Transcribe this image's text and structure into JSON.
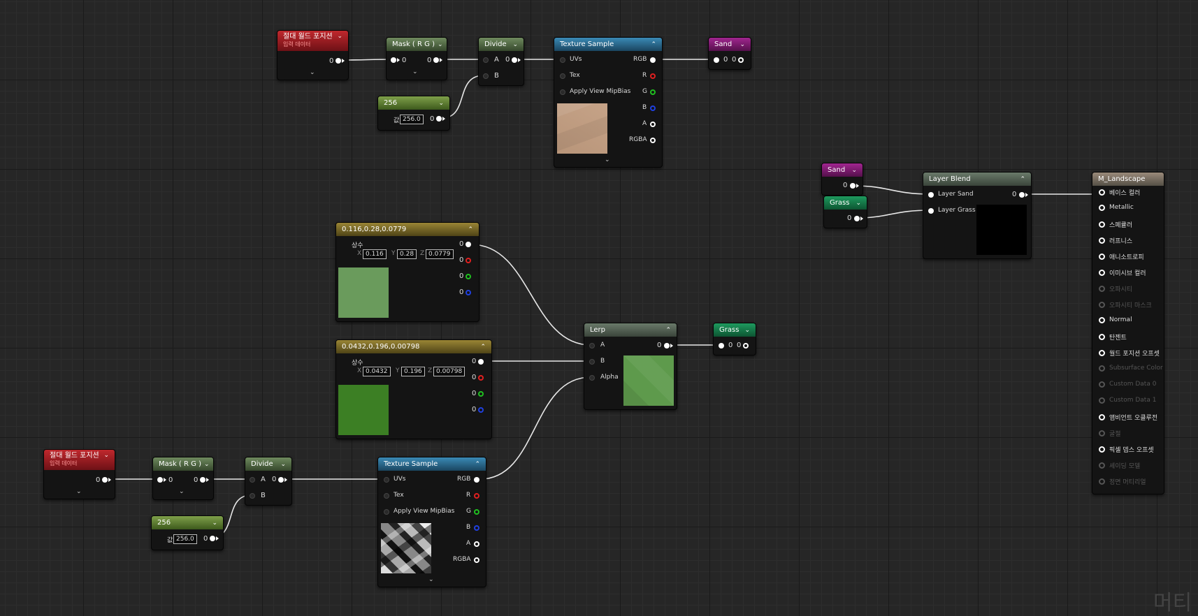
{
  "nodes": {
    "awp_top": {
      "title": "절대 월드 포지션",
      "subtitle": "입력 데이터",
      "out": "0"
    },
    "mask_top": {
      "title": "Mask ( R G )",
      "in": "0",
      "out": "0"
    },
    "divide_top": {
      "title": "Divide",
      "a": "A",
      "a_val": "0",
      "b": "B"
    },
    "const256_top": {
      "title": "256",
      "label": "값",
      "value": "256.0",
      "out": "0"
    },
    "tex_top": {
      "title": "Texture Sample",
      "uvs": "UVs",
      "tex": "Tex",
      "mip": "Apply View MipBias",
      "rgb": "RGB",
      "r": "R",
      "g": "G",
      "b": "B",
      "a": "A",
      "rgba": "RGBA",
      "color": "#c29d80"
    },
    "sand_out": {
      "title": "Sand",
      "v1": "0",
      "v2": "0"
    },
    "c3_a": {
      "title": "0.116,0.28,0.0779",
      "label": "상수",
      "x_lbl": "X",
      "x": "0.116",
      "y_lbl": "Y",
      "y": "0.28",
      "z_lbl": "Z",
      "z": "0.0779",
      "o1": "0",
      "o2": "0",
      "o3": "0",
      "o4": "0",
      "color": "#6a9b5c"
    },
    "c3_b": {
      "title": "0.0432,0.196,0.00798",
      "label": "상수",
      "x_lbl": "X",
      "x": "0.0432",
      "y_lbl": "Y",
      "y": "0.196",
      "z_lbl": "Z",
      "z": "0.00798",
      "o1": "0",
      "o2": "0",
      "o3": "0",
      "o4": "0",
      "color": "#3c7f24"
    },
    "lerp": {
      "title": "Lerp",
      "a": "A",
      "a_val": "0",
      "b": "B",
      "alpha": "Alpha"
    },
    "grass_out": {
      "title": "Grass",
      "v1": "0",
      "v2": "0"
    },
    "awp_bot": {
      "title": "절대 월드 포지션",
      "subtitle": "입력 데이터",
      "out": "0"
    },
    "mask_bot": {
      "title": "Mask ( R G )",
      "in": "0",
      "out": "0"
    },
    "divide_bot": {
      "title": "Divide",
      "a": "A",
      "a_val": "0",
      "b": "B"
    },
    "const256_bot": {
      "title": "256",
      "label": "값",
      "value": "256.0",
      "out": "0"
    },
    "tex_bot": {
      "title": "Texture Sample",
      "uvs": "UVs",
      "tex": "Tex",
      "mip": "Apply View MipBias",
      "rgb": "RGB",
      "r": "R",
      "g": "G",
      "b": "B",
      "a": "A",
      "rgba": "RGBA"
    },
    "sand_in": {
      "title": "Sand",
      "out": "0"
    },
    "grass_in": {
      "title": "Grass",
      "out": "0"
    },
    "layer_blend": {
      "title": "Layer Blend",
      "in1": "Layer Sand",
      "in2": "Layer Grass",
      "out": "0"
    },
    "m_landscape": {
      "title": "M_Landscape",
      "inputs": [
        {
          "label": "베이스 컬러",
          "enabled": true
        },
        {
          "label": "Metallic",
          "enabled": true
        },
        {
          "label": "스페큘러",
          "enabled": true
        },
        {
          "label": "러프니스",
          "enabled": true
        },
        {
          "label": "애니소트로피",
          "enabled": true
        },
        {
          "label": "이미시브 컬러",
          "enabled": true
        },
        {
          "label": "오파시티",
          "enabled": false
        },
        {
          "label": "오파시티 마스크",
          "enabled": false
        },
        {
          "label": "Normal",
          "enabled": true
        },
        {
          "label": "탄젠트",
          "enabled": true
        },
        {
          "label": "월드 포지션 오프셋",
          "enabled": true
        },
        {
          "label": "Subsurface Color",
          "enabled": false
        },
        {
          "label": "Custom Data 0",
          "enabled": false
        },
        {
          "label": "Custom Data 1",
          "enabled": false
        },
        {
          "label": "앰비언트 오클루전",
          "enabled": true
        },
        {
          "label": "굴절",
          "enabled": false
        },
        {
          "label": "픽셀 뎁스 오프셋",
          "enabled": true
        },
        {
          "label": "셰이딩 모델",
          "enabled": false
        },
        {
          "label": "정면 머티리얼",
          "enabled": false
        }
      ]
    }
  },
  "watermark": "머티"
}
